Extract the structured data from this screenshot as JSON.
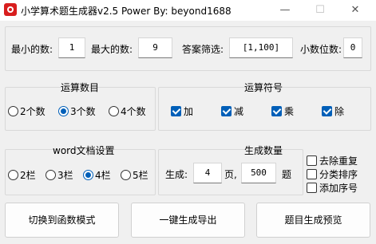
{
  "window": {
    "title": "小学算术题生成器v2.5  Power By:  beyond1688",
    "min_glyph": "—",
    "max_glyph": "☐",
    "close_glyph": "✕"
  },
  "range": {
    "min_label": "最小的数:",
    "min_value": "1",
    "max_label": "最大的数:",
    "max_value": "9",
    "filter_label": "答案筛选:",
    "filter_value": "[1,100]",
    "decimal_label": "小数位数:",
    "decimal_value": "0"
  },
  "operand_count": {
    "title": "运算数目",
    "options": [
      "2个数",
      "3个数",
      "4个数"
    ],
    "selected_index": 1
  },
  "operators": {
    "title": "运算符号",
    "items": [
      {
        "label": "加",
        "checked": true
      },
      {
        "label": "减",
        "checked": true
      },
      {
        "label": "乘",
        "checked": true
      },
      {
        "label": "除",
        "checked": true
      }
    ]
  },
  "word_settings": {
    "title": "word文档设置",
    "options": [
      "2栏",
      "3栏",
      "4栏",
      "5栏"
    ],
    "selected_index": 2
  },
  "generate": {
    "title": "生成数量",
    "label": "生成:",
    "pages_value": "4",
    "pages_unit": "页,",
    "count_value": "500",
    "count_unit": "题",
    "options": [
      {
        "label": "去除重复",
        "checked": false
      },
      {
        "label": "分类排序",
        "checked": false
      },
      {
        "label": "添加序号",
        "checked": false
      }
    ]
  },
  "buttons": {
    "function_mode": "切换到函数模式",
    "export": "一键生成导出",
    "preview": "题目生成预览"
  },
  "colors": {
    "accent": "#005fb8",
    "icon_red": "#d81e1e"
  }
}
